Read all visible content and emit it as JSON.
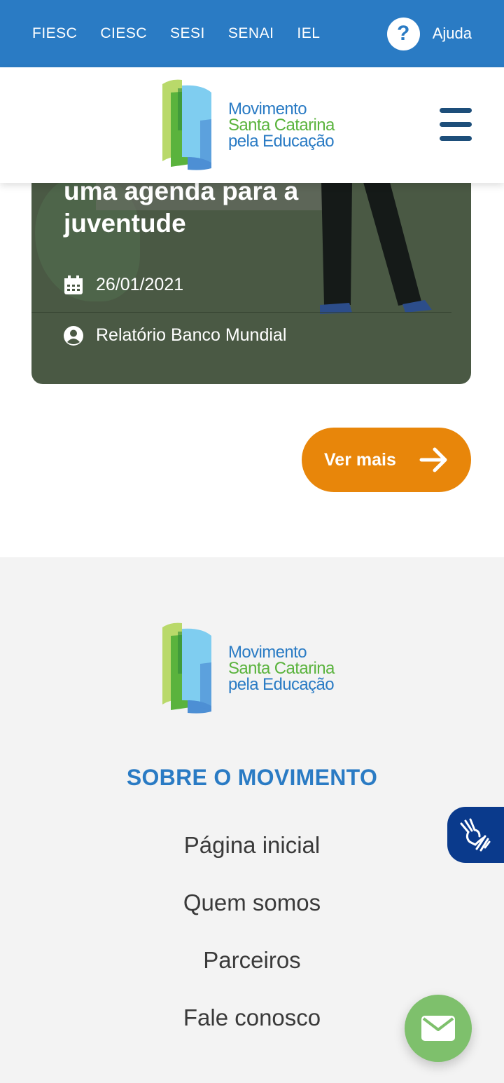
{
  "topbar": {
    "links": [
      "FIESC",
      "CIESC",
      "SESI",
      "SENAI",
      "IEL"
    ],
    "help_symbol": "?",
    "help_label": "Ajuda"
  },
  "brand": {
    "line1": "Movimento",
    "line2": "Santa Catarina",
    "line3": "pela Educação",
    "colors": {
      "blue": "#2a7bc4",
      "green": "#5ab33d",
      "light_green": "#b9d96a",
      "light_blue": "#7fcdf0"
    }
  },
  "card": {
    "title": "uma agenda para a juventude",
    "date": "26/01/2021",
    "author": "Relatório Banco Mundial",
    "date_icon": "calendar-icon",
    "author_icon": "user-circle-icon"
  },
  "ver_mais": {
    "label": "Ver mais",
    "color": "#e8860a"
  },
  "footer": {
    "heading": "SOBRE O MOVIMENTO",
    "nav": [
      "Página inicial",
      "Quem somos",
      "Parceiros",
      "Fale conosco"
    ]
  },
  "floating": {
    "libras_icon": "sign-language-icon",
    "contact_icon": "envelope-icon"
  }
}
